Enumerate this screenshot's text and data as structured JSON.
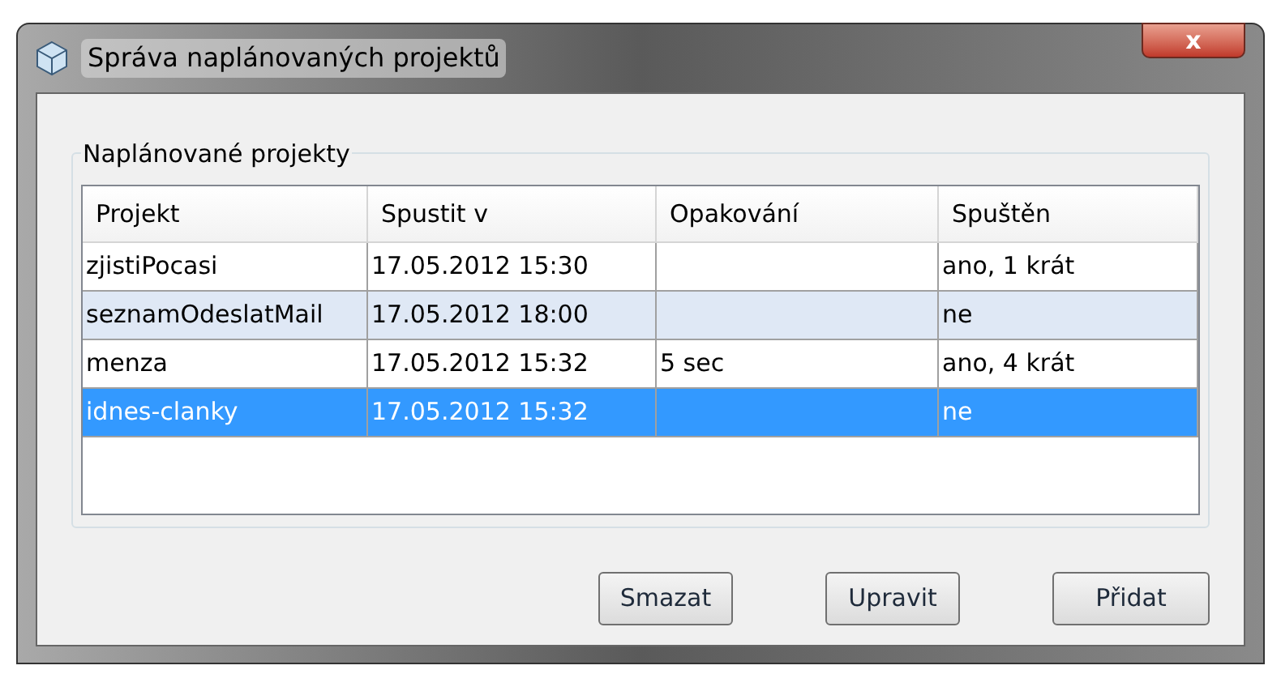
{
  "window": {
    "title": "Správa naplánovaných projektů",
    "close_label": "x"
  },
  "group": {
    "title": "Naplánované projekty"
  },
  "table": {
    "columns": [
      "Projekt",
      "Spustit v",
      "Opakování",
      "Spuštěn"
    ],
    "rows": [
      {
        "cells": [
          "zjistiPocasi",
          "17.05.2012 15:30",
          "",
          "ano, 1 krát"
        ],
        "selected": false
      },
      {
        "cells": [
          "seznamOdeslatMail",
          "17.05.2012 18:00",
          "",
          "ne"
        ],
        "selected": false
      },
      {
        "cells": [
          "menza",
          "17.05.2012 15:32",
          "5 sec",
          "ano, 4 krát"
        ],
        "selected": false
      },
      {
        "cells": [
          "idnes-clanky",
          "17.05.2012 15:32",
          "",
          "ne"
        ],
        "selected": true
      }
    ]
  },
  "buttons": [
    "Smazat",
    "Upravit",
    "Přidat"
  ]
}
